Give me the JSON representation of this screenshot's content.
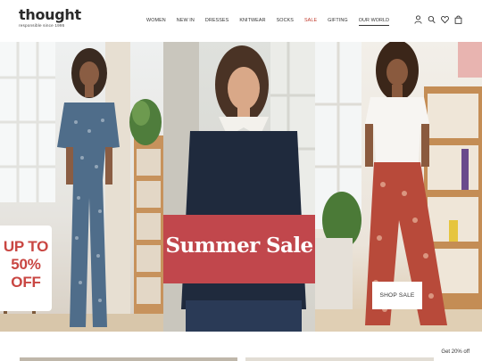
{
  "brand": {
    "wordmark": "thought",
    "tagline": "responsible since 1995"
  },
  "nav": {
    "items": [
      {
        "label": "WOMEN"
      },
      {
        "label": "NEW IN"
      },
      {
        "label": "DRESSES"
      },
      {
        "label": "KNITWEAR"
      },
      {
        "label": "SOCKS"
      },
      {
        "label": "SALE"
      },
      {
        "label": "GIFTING"
      },
      {
        "label": "OUR WORLD"
      }
    ]
  },
  "header_icons": [
    "account-icon",
    "search-icon",
    "wishlist-heart-icon",
    "bag-icon"
  ],
  "hero": {
    "promo_lines": [
      "UP TO",
      "50%",
      "OFF"
    ],
    "headline": "Summer Sale",
    "cta_label": "SHOP SALE"
  },
  "strip": {
    "text": "Get 20% off"
  },
  "colors": {
    "accent_red": "#c1474c",
    "promo_red": "#c94642",
    "sale_nav": "#c0392b"
  }
}
